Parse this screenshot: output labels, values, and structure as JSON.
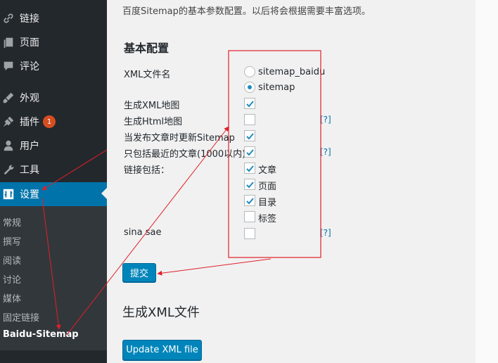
{
  "sidebar": {
    "items": [
      {
        "label": "链接",
        "icon": "link-icon"
      },
      {
        "label": "页面",
        "icon": "pages-icon"
      },
      {
        "label": "评论",
        "icon": "comments-icon"
      },
      {
        "label": "外观",
        "icon": "appearance-icon"
      },
      {
        "label": "插件",
        "icon": "plugins-icon",
        "badge": "1"
      },
      {
        "label": "用户",
        "icon": "users-icon"
      },
      {
        "label": "工具",
        "icon": "tools-icon"
      },
      {
        "label": "设置",
        "icon": "settings-icon",
        "active": true
      }
    ],
    "submenu": [
      "常规",
      "撰写",
      "阅读",
      "讨论",
      "媒体",
      "固定链接",
      "Baidu-Sitemap"
    ],
    "submenu_current": "Baidu-Sitemap"
  },
  "main": {
    "intro": "百度Sitemap的基本参数配置。以后将会根据需要丰富选项。",
    "section_title": "基本配置",
    "fields": {
      "xml_filename": {
        "label": "XML文件名",
        "options": [
          {
            "label": "sitemap_baidu",
            "checked": false
          },
          {
            "label": "sitemap",
            "checked": true
          }
        ]
      },
      "gen_xml": {
        "label": "生成XML地图",
        "checked": true
      },
      "gen_html": {
        "label": "生成Html地图",
        "checked": false,
        "help": "[?]"
      },
      "update_on_publish": {
        "label": "当发布文章时更新Sitemap",
        "checked": true
      },
      "recent_only": {
        "label": "只包括最近的文章(1000以内)",
        "checked": true,
        "help": "[?]"
      },
      "links_include": {
        "label": "链接包括：",
        "options": [
          {
            "label": "文章",
            "checked": true
          },
          {
            "label": "页面",
            "checked": true
          },
          {
            "label": "目录",
            "checked": true
          },
          {
            "label": "标签",
            "checked": false
          }
        ]
      },
      "sina_sae": {
        "label": "sina sae",
        "checked": false,
        "help": "[?]"
      }
    },
    "submit_label": "提交",
    "section2_title": "生成XML文件",
    "update_button_label": "Update XML file"
  },
  "colors": {
    "accent": "#0073aa",
    "button": "#0085ba",
    "annotation": "#e0202a",
    "sidebar_bg": "#23282d"
  }
}
